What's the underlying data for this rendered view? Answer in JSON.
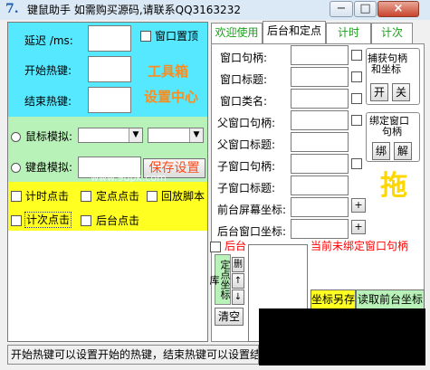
{
  "window": {
    "app_icon": "7.",
    "title": "键鼠助手   如需购买源码,请联系QQ3163232",
    "minimize_symbol": "−",
    "maximize_symbol": "□",
    "close_symbol": "×"
  },
  "left": {
    "delay_label": "延迟 /ms:",
    "start_hotkey_label": "开始热键:",
    "end_hotkey_label": "结束热键:",
    "topmost_label": "窗口置顶",
    "toolbox_line1": "工具箱",
    "toolbox_line2": "设置中心",
    "mouse_sim_label": "鼠标模拟:",
    "keyboard_sim_label": "键盘模拟:",
    "save_settings_label": "保存设置",
    "watermark": "www.9upk.com",
    "timed_click_label": "计时点击",
    "fixed_point_click_label": "定点点击",
    "replay_script_label": "回放脚本",
    "count_click_label": "计次点击",
    "background_click_label": "后台点击"
  },
  "tabs": [
    {
      "label": "欢迎使用"
    },
    {
      "label": "后台和定点"
    },
    {
      "label": "计时"
    },
    {
      "label": "计次"
    }
  ],
  "right": {
    "window_handle_label": "窗口句柄:",
    "window_title_label": "窗口标题:",
    "window_class_label": "窗口类名:",
    "parent_handle_label": "父窗口句柄:",
    "parent_title_label": "父窗口标题:",
    "child_handle_label": "子窗口句柄:",
    "child_title_label": "子窗口标题:",
    "screen_coord_label": "前台屏幕坐标:",
    "window_coord_label": "后台窗口坐标:",
    "plus_symbol": "+",
    "capture_group_line1": "捕获句柄",
    "capture_group_line2": "和坐标",
    "open_label": "开",
    "close_label": "关",
    "bind_group_line1": "绑定窗口",
    "bind_group_line2": "句柄",
    "bind_label": "绑",
    "unbind_label": "解",
    "drag_label": "拖",
    "background_label": "后台",
    "not_bound_text": "当前未绑定窗口句柄",
    "fixed_point_lib_label": "定点坐标库",
    "delete_label": "删",
    "up_arrow": "↑",
    "down_arrow": "↓",
    "clear_label": "清空",
    "save_coord_label": "坐标另存",
    "read_front_coord_label": "读取前台坐标"
  },
  "status": {
    "text": "开始热键可以设置开始的热键，结束热键可以设置结"
  },
  "colors": {
    "blue_area": "#55e8ff",
    "green_area": "#b8f2b8",
    "yellow_area": "#ffff22",
    "orange_text": "#ff8c1a",
    "green_tab_text": "#18a018",
    "red_text": "#ff0000",
    "coord_button_yellow": "#ffff22",
    "coord_button_green": "#b8f2b8"
  }
}
